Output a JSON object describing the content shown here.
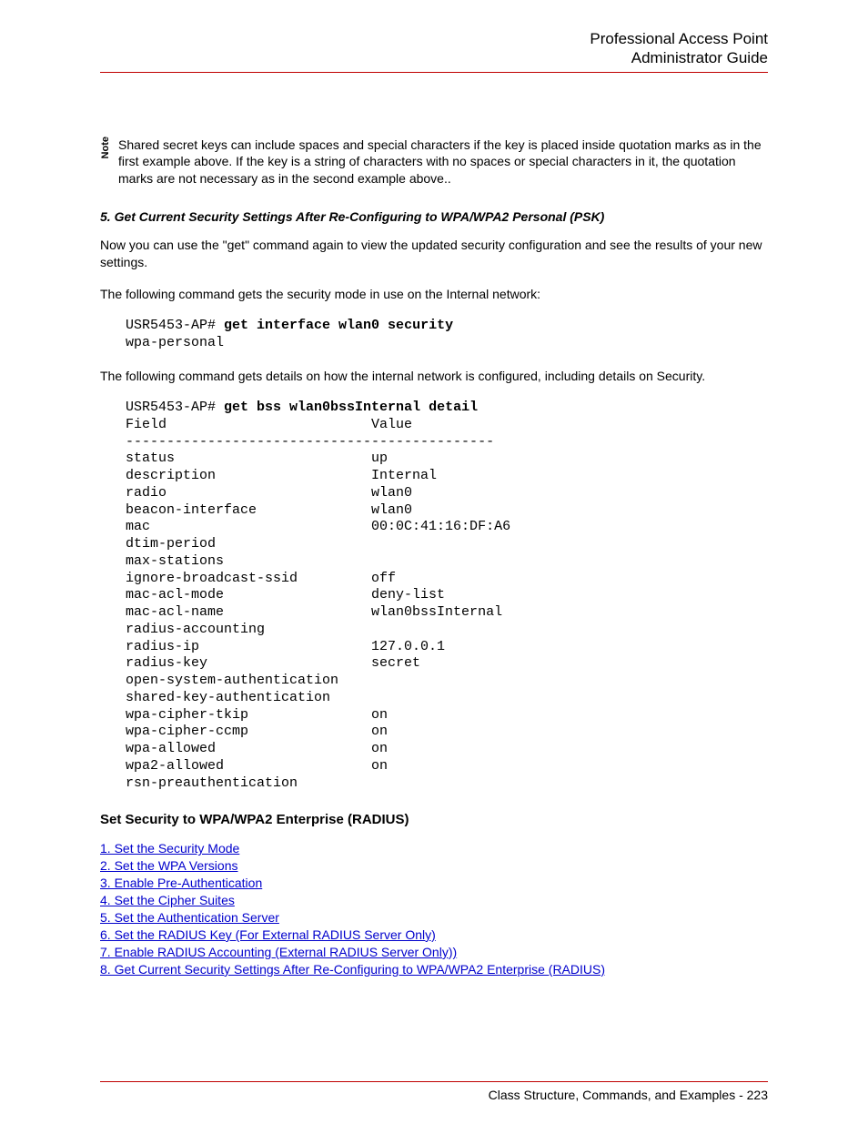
{
  "header": {
    "line1": "Professional Access Point",
    "line2": "Administrator Guide"
  },
  "note": {
    "label": "Note",
    "text": "Shared secret keys can include spaces and special characters if the key is placed inside quotation marks as in the first example above. If the key is a string of characters with no spaces or special characters in it, the quotation marks are not necessary as in the second example above.."
  },
  "section5": {
    "heading": "5. Get Current Security Settings After Re-Configuring to WPA/WPA2 Personal (PSK)",
    "para1": "Now you can use the \"get\" command again to view the updated security configuration and see the results of your new settings.",
    "para2": "The following command gets the security mode in use on the Internal network:",
    "code1prompt": "USR5453-AP# ",
    "code1cmd": "get interface wlan0 security",
    "code1out": "wpa-personal",
    "para3": "The following command gets details on how the internal network is configured, including details on Security.",
    "code2prompt": "USR5453-AP# ",
    "code2cmd": "get bss wlan0bssInternal detail",
    "code2body": "Field                         Value\n---------------------------------------------\nstatus                        up\ndescription                   Internal\nradio                         wlan0\nbeacon-interface              wlan0\nmac                           00:0C:41:16:DF:A6\ndtim-period\nmax-stations\nignore-broadcast-ssid         off\nmac-acl-mode                  deny-list\nmac-acl-name                  wlan0bssInternal\nradius-accounting\nradius-ip                     127.0.0.1\nradius-key                    secret\nopen-system-authentication\nshared-key-authentication\nwpa-cipher-tkip               on\nwpa-cipher-ccmp               on\nwpa-allowed                   on\nwpa2-allowed                  on\nrsn-preauthentication"
  },
  "enterprise": {
    "heading": "Set Security to WPA/WPA2 Enterprise (RADIUS)",
    "links": [
      "1. Set the Security Mode",
      "2. Set the WPA Versions",
      "3. Enable Pre-Authentication",
      "4. Set the Cipher Suites",
      "5. Set the Authentication Server",
      "6. Set the RADIUS Key (For External RADIUS Server Only)",
      "7. Enable RADIUS Accounting (External RADIUS Server Only))",
      "8. Get Current Security Settings After Re-Configuring to WPA/WPA2 Enterprise (RADIUS)"
    ]
  },
  "footer": {
    "text": "Class Structure, Commands, and Examples - 223"
  }
}
